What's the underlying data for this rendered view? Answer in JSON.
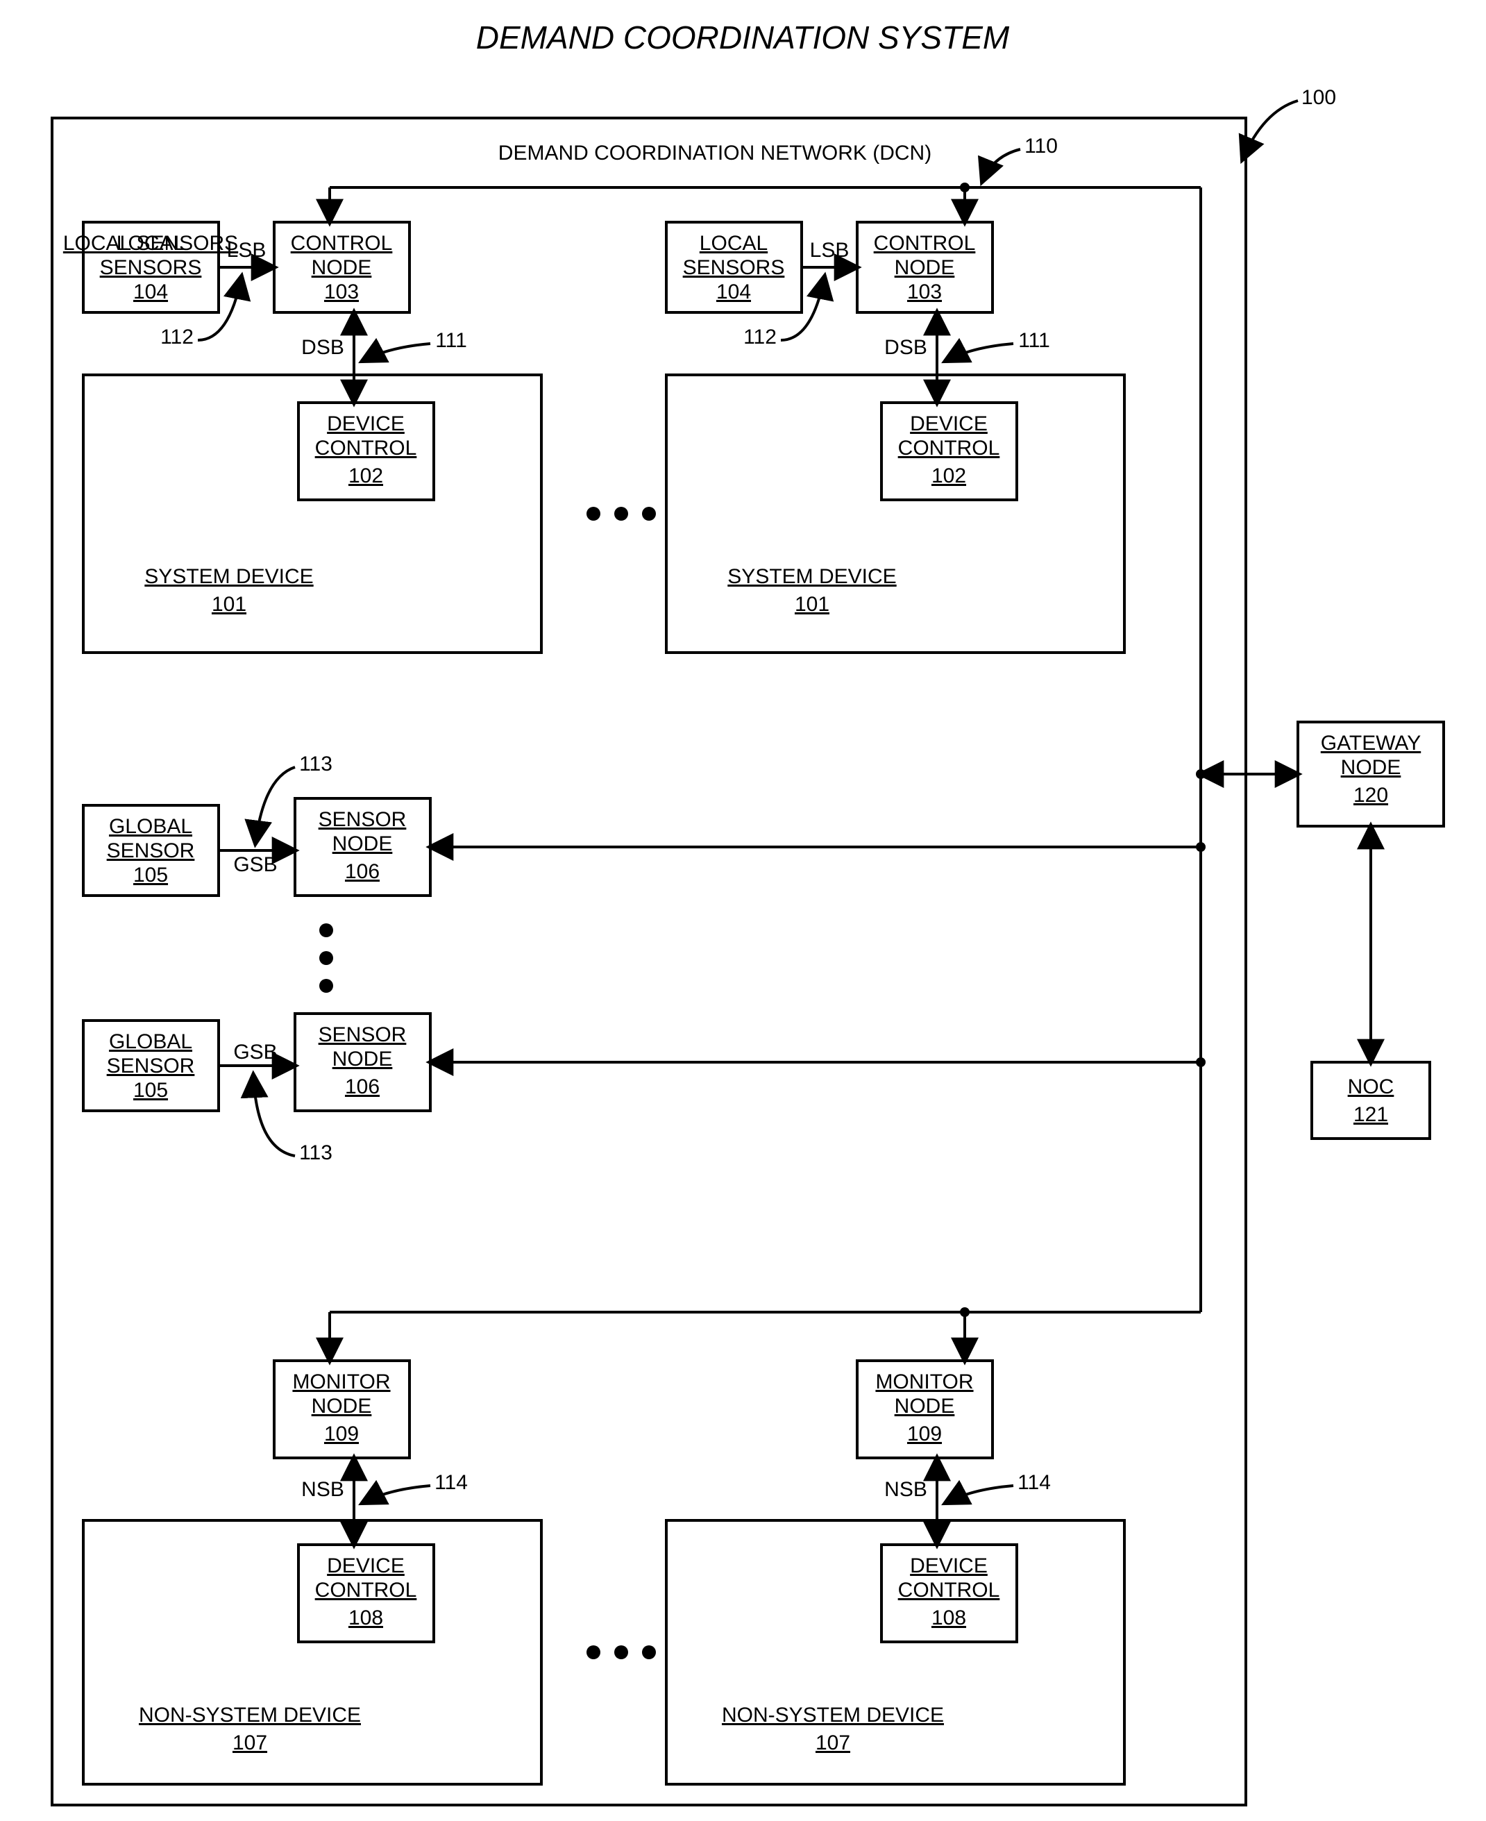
{
  "title": "DEMAND COORDINATION SYSTEM",
  "fignum": "100",
  "dcn_label": "DEMAND COORDINATION NETWORK (DCN)",
  "dcn_ref": "110",
  "lsb": "LSB",
  "dsb": "DSB",
  "gsb": "GSB",
  "nsb": "NSB",
  "local_sensors": "LOCAL SENSORS",
  "local_sensors_num": "104",
  "ls_ref": "112",
  "control_node": "CONTROL NODE",
  "control_node_num": "103",
  "dsb_ref": "111",
  "device_control": "DEVICE CONTROL",
  "device_control_num": "102",
  "system_device": "SYSTEM DEVICE",
  "system_device_num": "101",
  "global_sensor": "GLOBAL SENSOR",
  "global_sensor_num": "105",
  "sensor_node": "SENSOR NODE",
  "sensor_node_num": "106",
  "gsb_ref": "113",
  "gateway_node": "GATEWAY NODE",
  "gateway_node_num": "120",
  "noc": "NOC",
  "noc_num": "121",
  "monitor_node": "MONITOR NODE",
  "monitor_node_num": "109",
  "nsb_ref": "114",
  "device_control2_num": "108",
  "non_system_device": "NON-SYSTEM DEVICE",
  "non_system_device_num": "107"
}
